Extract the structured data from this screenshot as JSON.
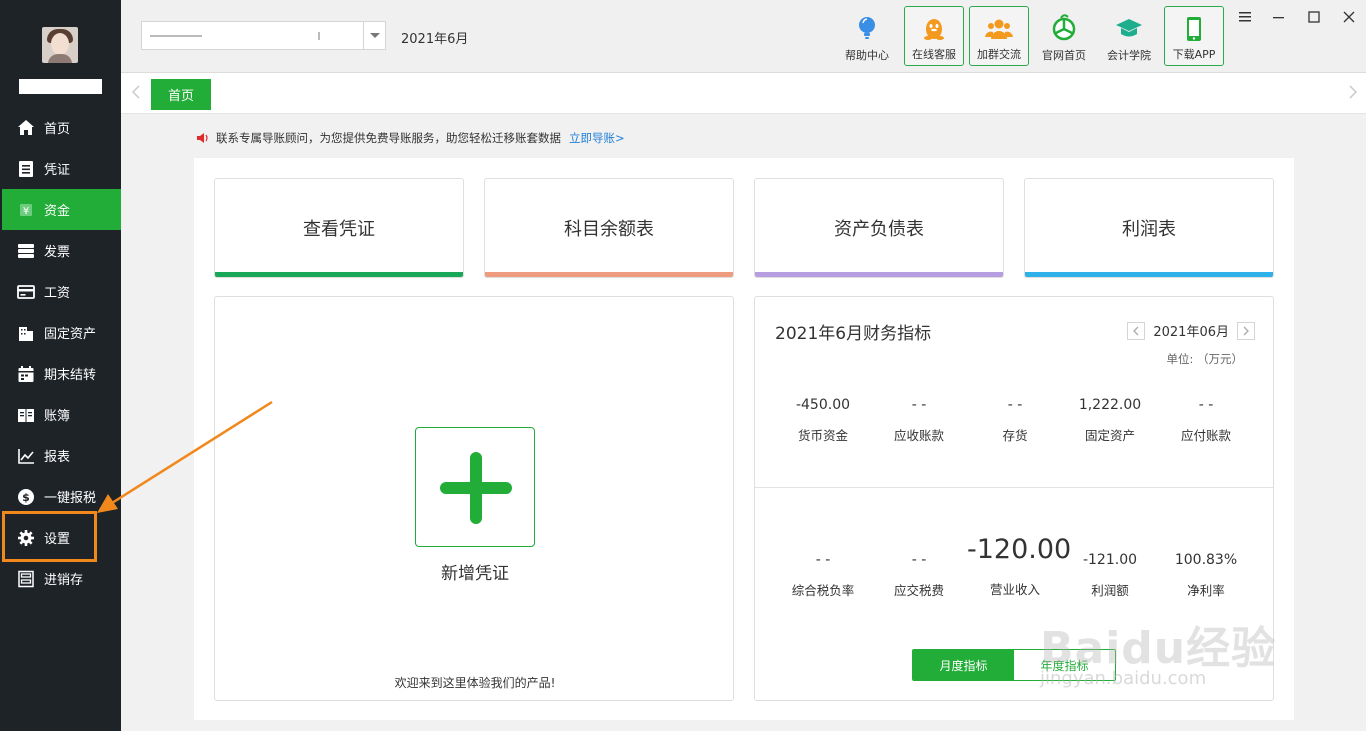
{
  "sidebar": {
    "items": [
      {
        "label": "首页",
        "icon": "home-icon"
      },
      {
        "label": "凭证",
        "icon": "voucher-icon"
      },
      {
        "label": "资金",
        "icon": "yuan-icon"
      },
      {
        "label": "发票",
        "icon": "invoice-icon"
      },
      {
        "label": "工资",
        "icon": "salary-card-icon"
      },
      {
        "label": "固定资产",
        "icon": "building-icon"
      },
      {
        "label": "期末结转",
        "icon": "calendar-icon"
      },
      {
        "label": "账簿",
        "icon": "ledger-book-icon"
      },
      {
        "label": "报表",
        "icon": "chart-line-icon"
      },
      {
        "label": "一键报税",
        "icon": "dollar-circle-icon"
      },
      {
        "label": "设置",
        "icon": "gear-icon"
      },
      {
        "label": "进销存",
        "icon": "inventory-icon"
      }
    ],
    "active_index": 2
  },
  "header": {
    "period": "2021年6月",
    "tools": [
      {
        "label": "帮助中心",
        "icon": "lightbulb-icon"
      },
      {
        "label": "在线客服",
        "icon": "qq-penguin-icon"
      },
      {
        "label": "加群交流",
        "icon": "group-chat-icon"
      },
      {
        "label": "官网首页",
        "icon": "website-home-icon"
      },
      {
        "label": "会计学院",
        "icon": "graduation-cap-icon"
      },
      {
        "label": "下载APP",
        "icon": "mobile-phone-icon"
      }
    ]
  },
  "tabs": {
    "home": "首页"
  },
  "notice": {
    "text": "联系专属导账顾问，为您提供免费导账服务，助您轻松迁移账套数据",
    "link": "立即导账>"
  },
  "quick_cards": [
    {
      "label": "查看凭证",
      "color": "#19a85a"
    },
    {
      "label": "科目余额表",
      "color": "#ee9b80"
    },
    {
      "label": "资产负债表",
      "color": "#b79ee0"
    },
    {
      "label": "利润表",
      "color": "#2eb0e8"
    }
  ],
  "new_voucher": {
    "label": "新增凭证",
    "welcome": "欢迎来到这里体验我们的产品!"
  },
  "finance": {
    "title": "2021年6月财务指标",
    "month": "2021年06月",
    "unit": "单位: （万元）",
    "row1": [
      {
        "value": "-450.00",
        "label": "货币资金"
      },
      {
        "value": "- -",
        "label": "应收账款"
      },
      {
        "value": "- -",
        "label": "存货"
      },
      {
        "value": "1,222.00",
        "label": "固定资产"
      },
      {
        "value": "- -",
        "label": "应付账款"
      }
    ],
    "row2": [
      {
        "value": "- -",
        "label": "综合税负率"
      },
      {
        "value": "- -",
        "label": "应交税费"
      },
      {
        "value": "-120.00",
        "label": "营业收入"
      },
      {
        "value": "-121.00",
        "label": "利润额"
      },
      {
        "value": "100.83%",
        "label": "净利率"
      }
    ],
    "toggle_monthly": "月度指标",
    "toggle_yearly": "年度指标"
  },
  "watermark": {
    "brand": "Baidu经验",
    "url": "jingyan.baidu.com"
  },
  "colors": {
    "accent": "#22ac38",
    "sidebar_bg": "#1e2328",
    "annotation": "#f0881c"
  }
}
